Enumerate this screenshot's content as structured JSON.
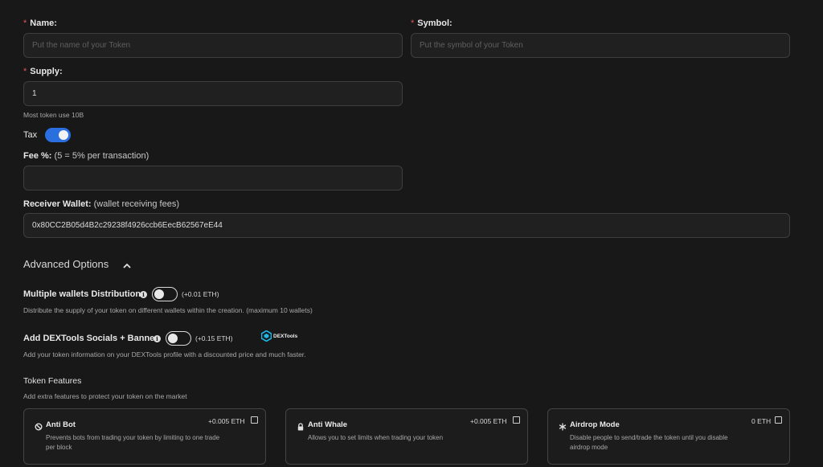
{
  "form": {
    "name": {
      "label": "Name:",
      "placeholder": "Put the name of your Token"
    },
    "symbol": {
      "label": "Symbol:",
      "placeholder": "Put the symbol of your Token"
    },
    "supply": {
      "label": "Supply:",
      "value": "1",
      "hint": "Most token use 10B"
    },
    "tax": {
      "label": "Tax",
      "enabled": true
    },
    "fee": {
      "label": "Fee %:",
      "sublabel": "(5 = 5% per transaction)",
      "value": ""
    },
    "receiver": {
      "label": "Receiver Wallet:",
      "sublabel": "(wallet receiving fees)",
      "value": "0x80CC2B05d4B2c29238f4926ccb6EecB62567eE44"
    }
  },
  "advanced": {
    "title": "Advanced Options",
    "multi_wallets": {
      "label": "Multiple wallets Distribution",
      "price": "(+0.01 ETH)",
      "enabled": false,
      "description": "Distribute the supply of your token on different wallets within the creation. (maximum 10 wallets)"
    },
    "dextools": {
      "label": "Add DEXTools Socials + Banner",
      "price": "(+0.15 ETH)",
      "enabled": false,
      "logo_text": "DEXTools",
      "description": "Add your token information on your DEXTools profile with a discounted price and much faster."
    }
  },
  "features": {
    "title": "Token Features",
    "subtitle": "Add extra features to protect your token on the market",
    "cards": [
      {
        "title": "Anti Bot",
        "icon": "ban-icon",
        "price": "+0.005 ETH",
        "checked": false,
        "description": "Prevents bots from trading your token by limiting to one trade per block"
      },
      {
        "title": "Anti Whale",
        "icon": "lock-icon",
        "price": "+0.005 ETH",
        "checked": false,
        "description": "Allows you to set limits when trading your token"
      },
      {
        "title": "Airdrop Mode",
        "icon": "snowflake-icon",
        "price": "0 ETH",
        "checked": false,
        "description": "Disable people to send/trade the token until you disable airdrop mode"
      }
    ]
  },
  "colors": {
    "background": "#181818",
    "accent": "#2a6fe0",
    "required": "#e25555"
  }
}
